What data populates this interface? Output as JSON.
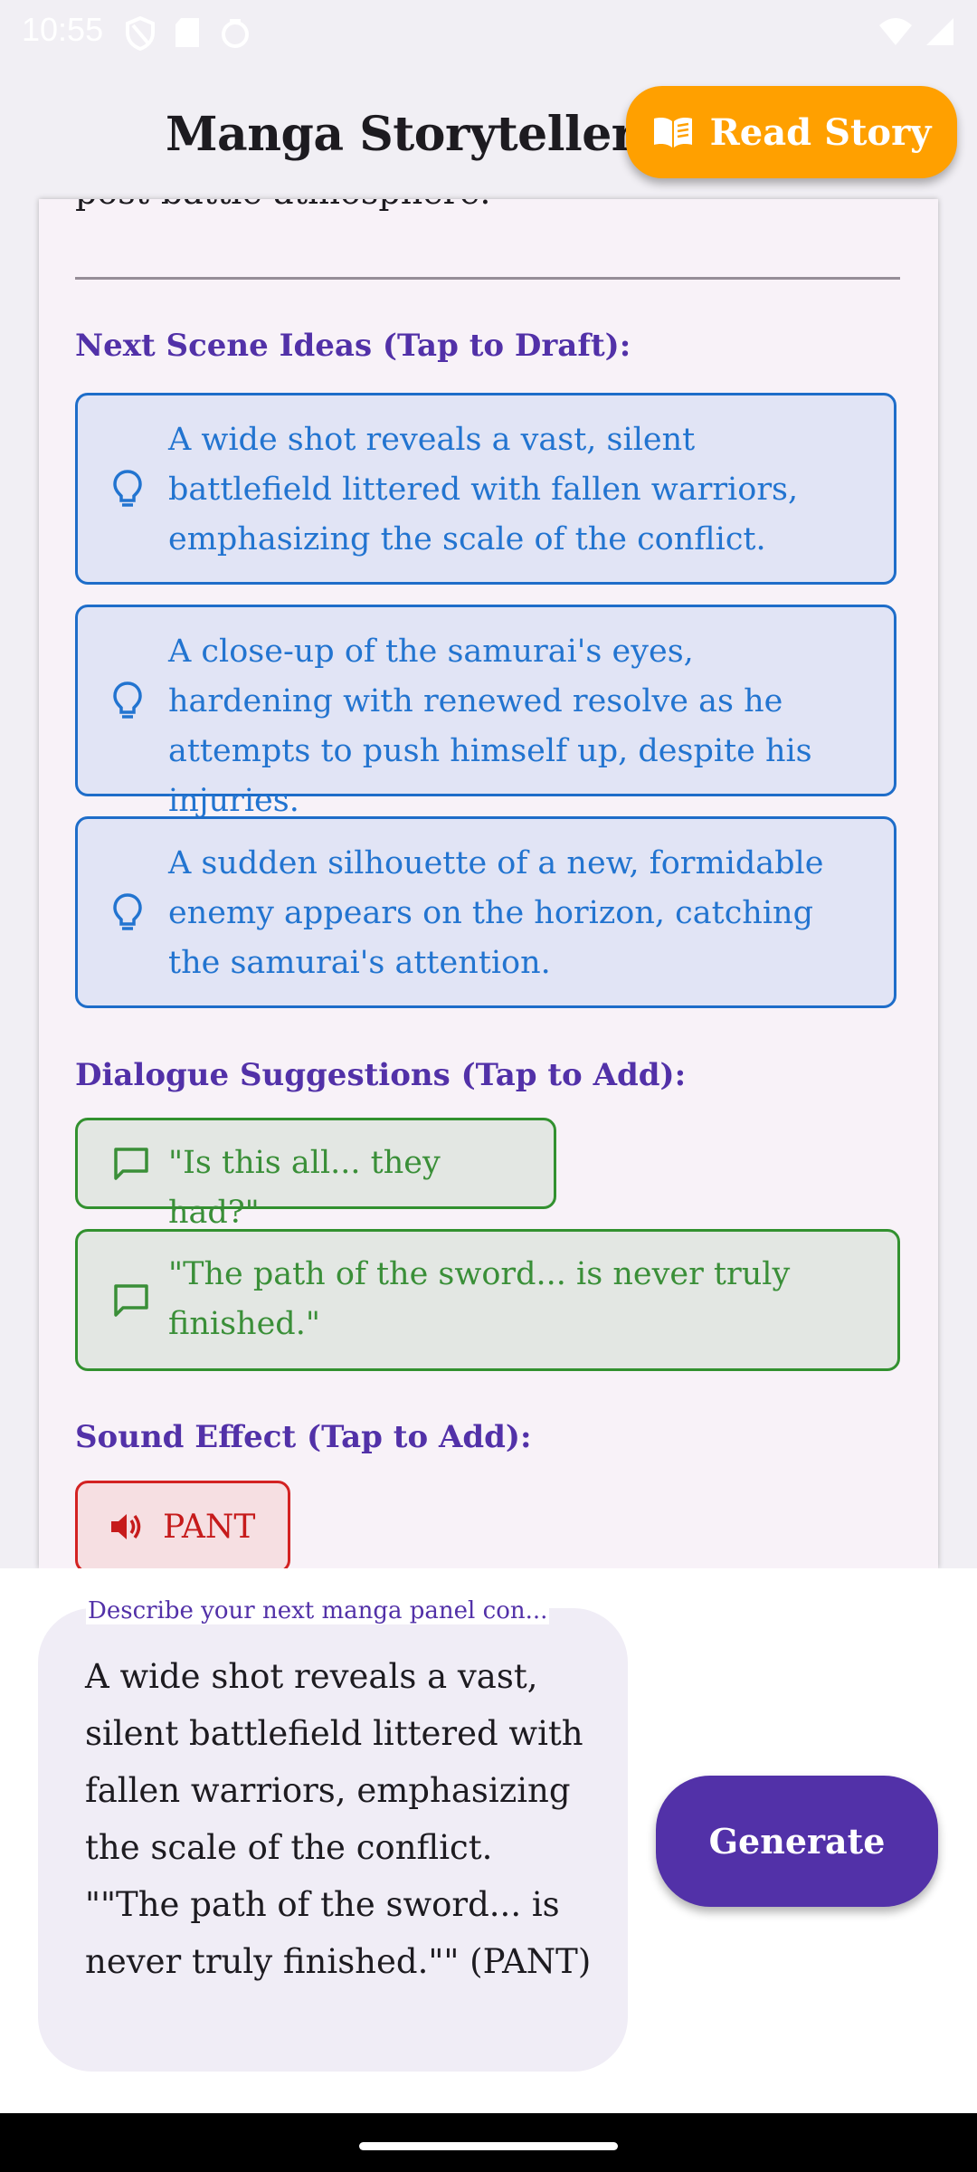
{
  "status_bar": {
    "time": "10:55"
  },
  "app_bar": {
    "title": "Manga Storyteller",
    "read_story_label": "Read Story",
    "colors": {
      "read_story_bg": "#ffa000"
    }
  },
  "story": {
    "cut_off_text": "post-battle atmosphere."
  },
  "next_scene": {
    "title": "Next Scene Ideas (Tap to Draft):",
    "items": [
      {
        "text": "A wide shot reveals a vast, silent battlefield littered with fallen warriors, emphasizing the scale of the conflict.",
        "icon": "lightbulb-icon"
      },
      {
        "text": "A close-up of the samurai's eyes, hardening with renewed resolve as he attempts to push himself up, despite his injuries.",
        "icon": "lightbulb-icon"
      },
      {
        "text": "A sudden silhouette of a new, formidable enemy appears on the horizon, catching the samurai's attention.",
        "icon": "lightbulb-icon"
      }
    ]
  },
  "dialogue": {
    "title": "Dialogue Suggestions (Tap to Add):",
    "items": [
      {
        "text": "\"Is this all... they had?\"",
        "icon": "speech-bubble-icon"
      },
      {
        "text": "\"The path of the sword... is never truly finished.\"",
        "icon": "speech-bubble-icon"
      }
    ]
  },
  "sound_effect": {
    "title": "Sound Effect (Tap to Add):",
    "items": [
      {
        "text": "PANT",
        "icon": "speaker-icon"
      }
    ]
  },
  "input": {
    "label": "Describe your next manga panel con...",
    "value": "A wide shot reveals a vast, silent battlefield littered with fallen warriors, emphasizing the scale of the conflict. \"\"The path of the sword... is never truly finished.\"\"  (PANT)"
  },
  "generate_label": "Generate",
  "colors": {
    "primary": "#5231a8",
    "idea": "#2274d0",
    "dialogue": "#3a8f38",
    "sfx": "#c61b1b"
  }
}
